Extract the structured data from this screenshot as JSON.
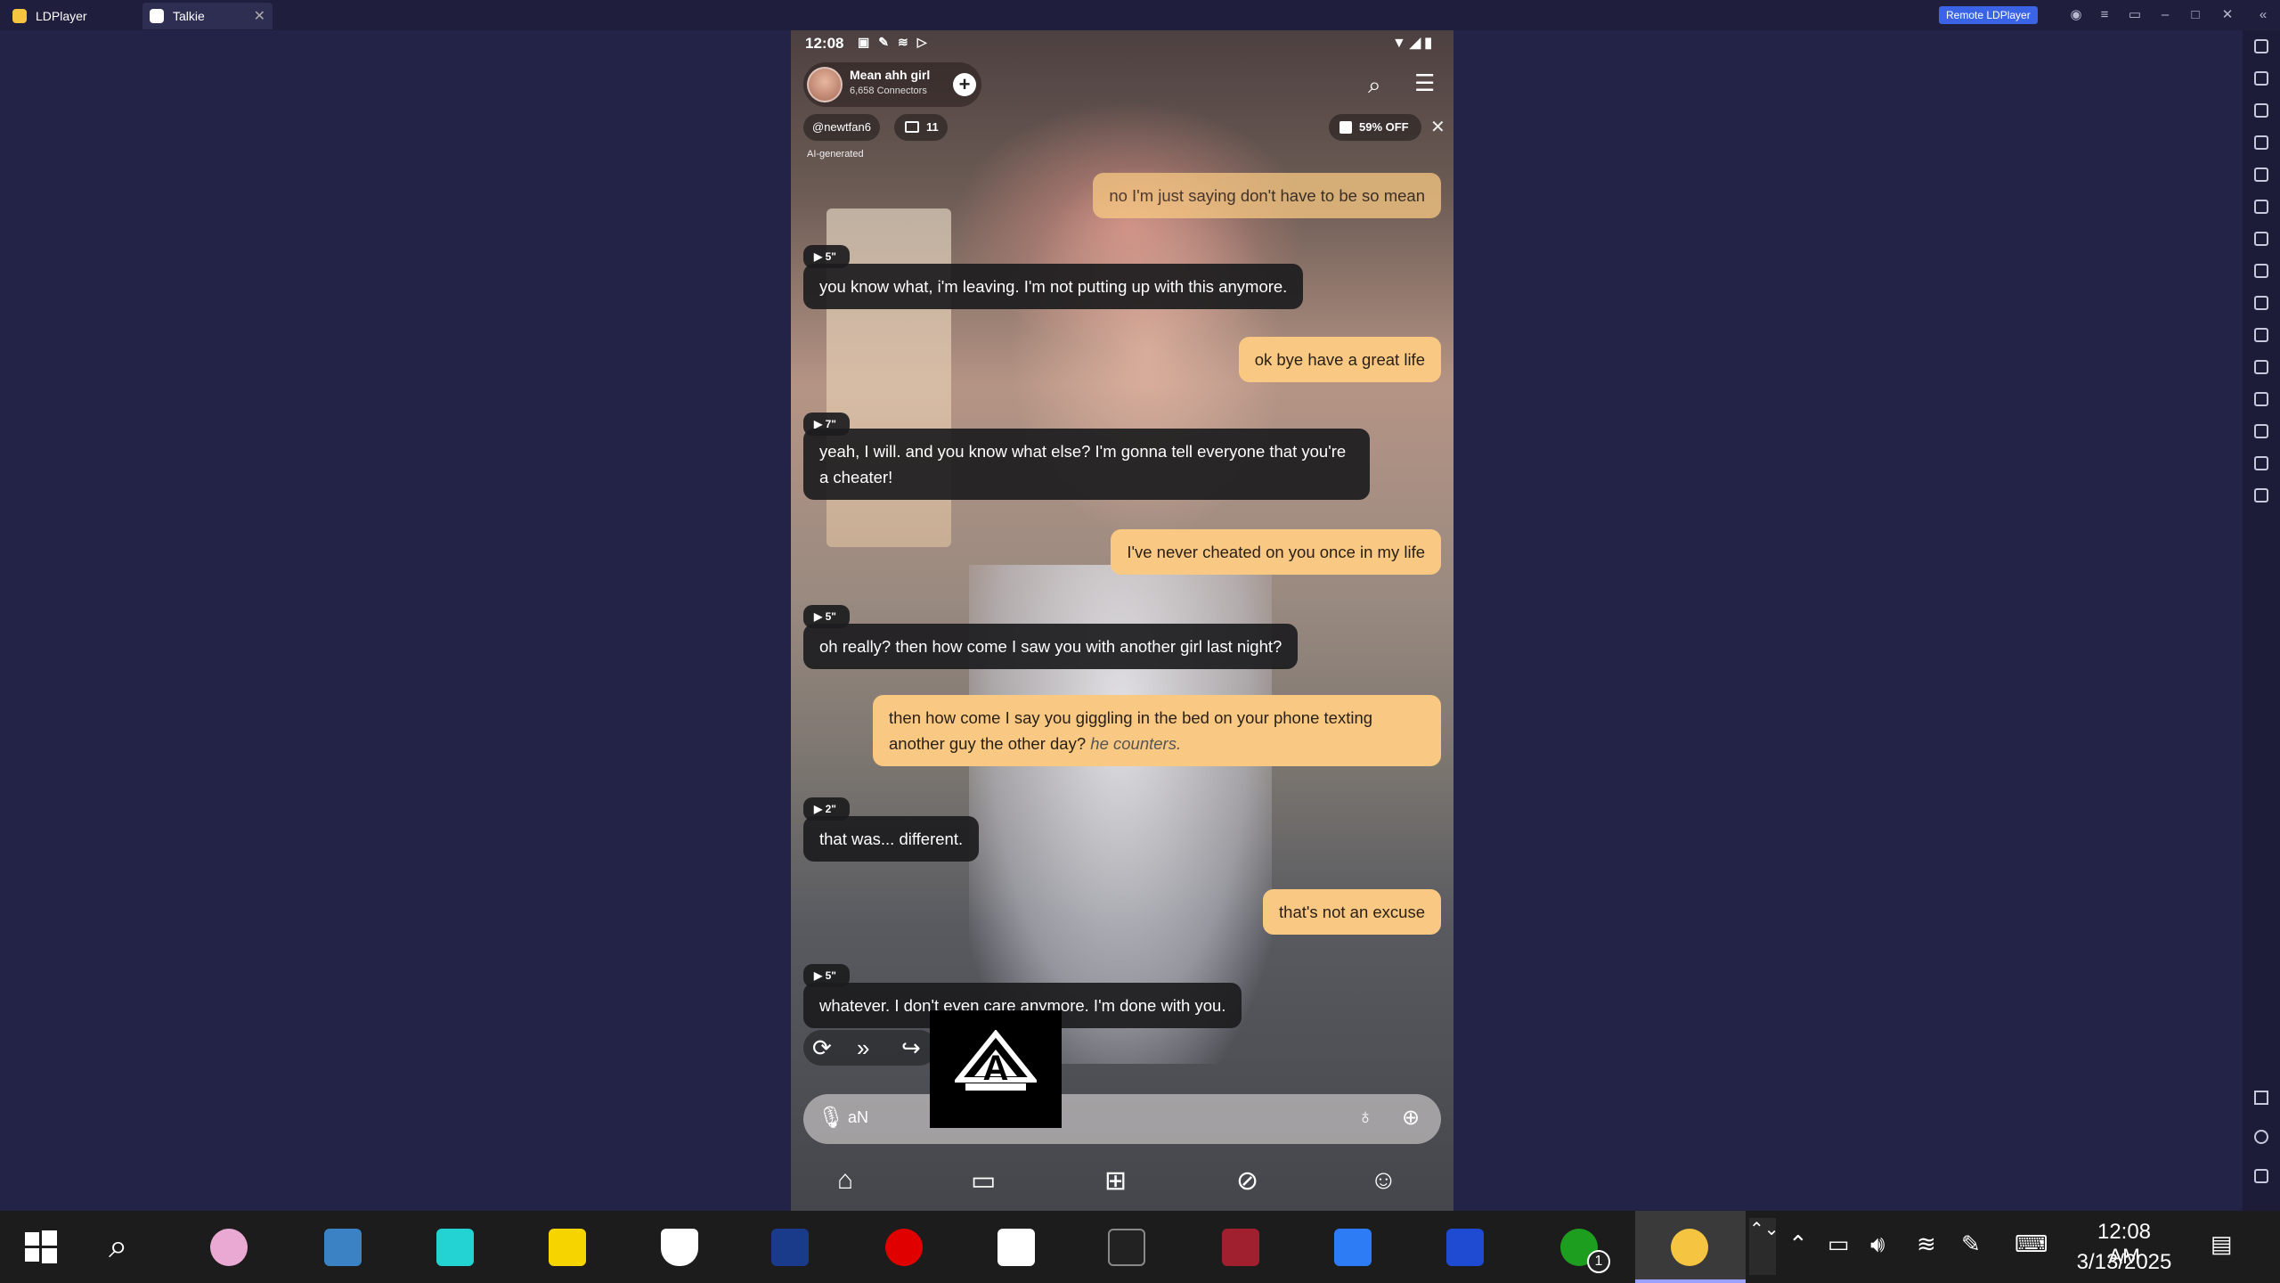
{
  "window": {
    "tabs": [
      {
        "label": "LDPlayer"
      },
      {
        "label": "Talkie"
      }
    ],
    "remote_label": "Remote LDPlayer"
  },
  "status": {
    "time": "12:08"
  },
  "character": {
    "name": "Mean ahh girl",
    "connectors": "6,658 Connectors"
  },
  "toolbar": {
    "username": "@newtfan6",
    "chat_count": "11",
    "offer": "59% OFF",
    "ai_label": "AI-generated"
  },
  "messages": [
    {
      "from": "user",
      "text": "no I'm just saying don't have to be so mean"
    },
    {
      "from": "bot",
      "duration": "▶ 5\"",
      "text": "you know what, i'm leaving. I'm not putting up with this anymore."
    },
    {
      "from": "user",
      "text": "ok bye have a great life"
    },
    {
      "from": "bot",
      "duration": "▶ 7\"",
      "text": "yeah, I will. and you know what else? I'm gonna tell everyone that you're a cheater!"
    },
    {
      "from": "user",
      "text": "I've never cheated on you once in my life"
    },
    {
      "from": "bot",
      "duration": "▶ 5\"",
      "text": "oh really? then how come I saw you with another girl last night?"
    },
    {
      "from": "user",
      "text": "then how come I say you giggling in the bed on your phone texting another guy the other day?",
      "emote": "he counters."
    },
    {
      "from": "bot",
      "duration": "▶ 2\"",
      "text": "that was... different."
    },
    {
      "from": "user",
      "text": "that's not an excuse"
    },
    {
      "from": "bot",
      "duration": "▶ 5\"",
      "text": "whatever. I don't even care anymore. I'm done with you."
    }
  ],
  "input": {
    "value": "aN"
  },
  "taskbar": {
    "clock_time": "12:08 AM",
    "clock_date": "3/13/2025",
    "xbox_badge": "1"
  },
  "icons": {
    "search": "search-icon",
    "menu": "menu-icon",
    "mic": "microphone-icon",
    "hint": "lightbulb-icon",
    "plus": "plus-icon"
  },
  "colors": {
    "user_bubble": "#f9c983",
    "bot_bubble": "#1c1c1e",
    "remote_btn": "#3b63e6",
    "emulator_bg": "#232347"
  }
}
